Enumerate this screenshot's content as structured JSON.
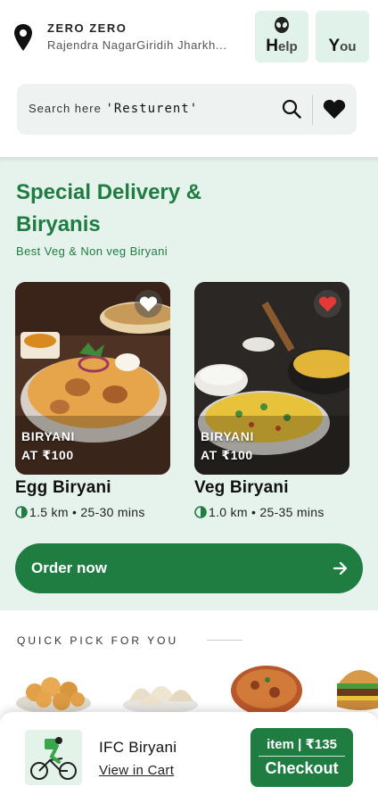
{
  "header": {
    "location_title": "ZERO ZERO",
    "location_address": "Rajendra NagarGiridih Jharkh...",
    "help_label_first": "H",
    "help_label_rest": "elp",
    "you_label_first": "Y",
    "you_label_rest": "ou",
    "icons": {
      "location": "map-pin-icon",
      "help": "alien-icon"
    }
  },
  "search": {
    "prefix": "Search here",
    "query": "'Resturent'",
    "icons": {
      "search": "search-icon",
      "favorites": "heart-icon"
    }
  },
  "special": {
    "title": "Special Delivery & Biryanis",
    "subtitle": "Best Veg & Non veg Biryani",
    "cards": [
      {
        "tag_line1": "BIRYANI",
        "tag_line2": "AT ₹100",
        "name": "Egg Biryani",
        "distance": "1.5 km",
        "time": "25-30 mins",
        "favorited": false
      },
      {
        "tag_line1": "BIRYANI",
        "tag_line2": "AT ₹100",
        "name": "Veg Biryani",
        "distance": "1.0 km",
        "time": "25-35 mins",
        "favorited": true
      }
    ],
    "order_button": "Order now"
  },
  "quick_pick": {
    "title": "QUICK PICK FOR YOU",
    "items": [
      "pani-puri-image",
      "momos-image",
      "biryani-image",
      "burger-image"
    ]
  },
  "cart": {
    "name": "IFC Biryani",
    "view_label": "View in Cart",
    "item_label": "item | ₹135",
    "checkout_label": "Checkout"
  },
  "colors": {
    "brand_green": "#1f7d42",
    "section_bg": "#e6f3ec",
    "chip_bg": "#e0f2ea",
    "favorite_red": "#e53935"
  }
}
